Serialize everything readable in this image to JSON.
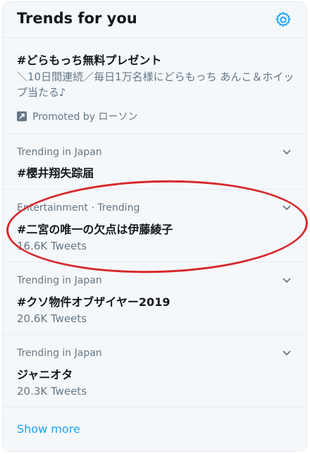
{
  "header": {
    "title": "Trends for you",
    "settings_icon": "gear-icon"
  },
  "promoted": {
    "name": "#どらもっち無料プレゼント",
    "description": "＼10日間連続／毎日1万名様にどらもっち あんこ＆ホイップ当たる♪",
    "label": "Promoted by ローソン"
  },
  "trends": [
    {
      "context": "Trending in Japan",
      "name": "#櫻井翔失踪届",
      "count": ""
    },
    {
      "context": "Entertainment · Trending",
      "name": "#二宮の唯一の欠点は伊藤綾子",
      "count": "16.6K Tweets"
    },
    {
      "context": "Trending in Japan",
      "name": "#クソ物件オブザイヤー2019",
      "count": "20.6K Tweets"
    },
    {
      "context": "Trending in Japan",
      "name": "ジャニオタ",
      "count": "20.3K Tweets"
    }
  ],
  "show_more": "Show more",
  "colors": {
    "accent": "#1da1f2",
    "annotation": "#d6282c",
    "background": "#f5f8fa"
  }
}
